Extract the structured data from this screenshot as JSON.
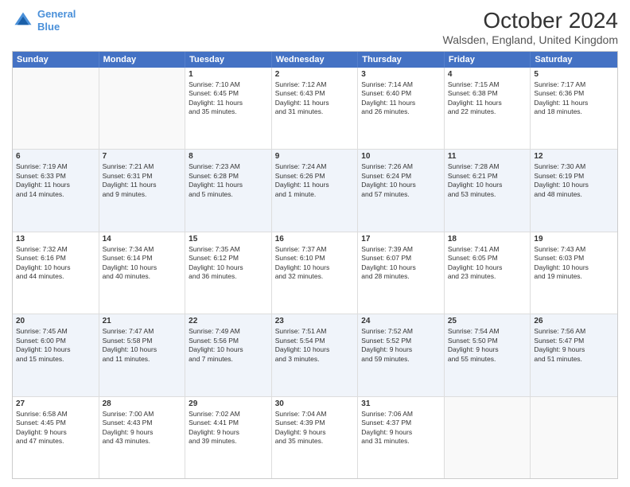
{
  "header": {
    "logo_line1": "General",
    "logo_line2": "Blue",
    "title": "October 2024",
    "subtitle": "Walsden, England, United Kingdom"
  },
  "days": [
    "Sunday",
    "Monday",
    "Tuesday",
    "Wednesday",
    "Thursday",
    "Friday",
    "Saturday"
  ],
  "rows": [
    [
      {
        "day": "",
        "info": [],
        "empty": true
      },
      {
        "day": "",
        "info": [],
        "empty": true
      },
      {
        "day": "1",
        "info": [
          "Sunrise: 7:10 AM",
          "Sunset: 6:45 PM",
          "Daylight: 11 hours",
          "and 35 minutes."
        ],
        "empty": false
      },
      {
        "day": "2",
        "info": [
          "Sunrise: 7:12 AM",
          "Sunset: 6:43 PM",
          "Daylight: 11 hours",
          "and 31 minutes."
        ],
        "empty": false
      },
      {
        "day": "3",
        "info": [
          "Sunrise: 7:14 AM",
          "Sunset: 6:40 PM",
          "Daylight: 11 hours",
          "and 26 minutes."
        ],
        "empty": false
      },
      {
        "day": "4",
        "info": [
          "Sunrise: 7:15 AM",
          "Sunset: 6:38 PM",
          "Daylight: 11 hours",
          "and 22 minutes."
        ],
        "empty": false
      },
      {
        "day": "5",
        "info": [
          "Sunrise: 7:17 AM",
          "Sunset: 6:36 PM",
          "Daylight: 11 hours",
          "and 18 minutes."
        ],
        "empty": false
      }
    ],
    [
      {
        "day": "6",
        "info": [
          "Sunrise: 7:19 AM",
          "Sunset: 6:33 PM",
          "Daylight: 11 hours",
          "and 14 minutes."
        ],
        "empty": false
      },
      {
        "day": "7",
        "info": [
          "Sunrise: 7:21 AM",
          "Sunset: 6:31 PM",
          "Daylight: 11 hours",
          "and 9 minutes."
        ],
        "empty": false
      },
      {
        "day": "8",
        "info": [
          "Sunrise: 7:23 AM",
          "Sunset: 6:28 PM",
          "Daylight: 11 hours",
          "and 5 minutes."
        ],
        "empty": false
      },
      {
        "day": "9",
        "info": [
          "Sunrise: 7:24 AM",
          "Sunset: 6:26 PM",
          "Daylight: 11 hours",
          "and 1 minute."
        ],
        "empty": false
      },
      {
        "day": "10",
        "info": [
          "Sunrise: 7:26 AM",
          "Sunset: 6:24 PM",
          "Daylight: 10 hours",
          "and 57 minutes."
        ],
        "empty": false
      },
      {
        "day": "11",
        "info": [
          "Sunrise: 7:28 AM",
          "Sunset: 6:21 PM",
          "Daylight: 10 hours",
          "and 53 minutes."
        ],
        "empty": false
      },
      {
        "day": "12",
        "info": [
          "Sunrise: 7:30 AM",
          "Sunset: 6:19 PM",
          "Daylight: 10 hours",
          "and 48 minutes."
        ],
        "empty": false
      }
    ],
    [
      {
        "day": "13",
        "info": [
          "Sunrise: 7:32 AM",
          "Sunset: 6:16 PM",
          "Daylight: 10 hours",
          "and 44 minutes."
        ],
        "empty": false
      },
      {
        "day": "14",
        "info": [
          "Sunrise: 7:34 AM",
          "Sunset: 6:14 PM",
          "Daylight: 10 hours",
          "and 40 minutes."
        ],
        "empty": false
      },
      {
        "day": "15",
        "info": [
          "Sunrise: 7:35 AM",
          "Sunset: 6:12 PM",
          "Daylight: 10 hours",
          "and 36 minutes."
        ],
        "empty": false
      },
      {
        "day": "16",
        "info": [
          "Sunrise: 7:37 AM",
          "Sunset: 6:10 PM",
          "Daylight: 10 hours",
          "and 32 minutes."
        ],
        "empty": false
      },
      {
        "day": "17",
        "info": [
          "Sunrise: 7:39 AM",
          "Sunset: 6:07 PM",
          "Daylight: 10 hours",
          "and 28 minutes."
        ],
        "empty": false
      },
      {
        "day": "18",
        "info": [
          "Sunrise: 7:41 AM",
          "Sunset: 6:05 PM",
          "Daylight: 10 hours",
          "and 23 minutes."
        ],
        "empty": false
      },
      {
        "day": "19",
        "info": [
          "Sunrise: 7:43 AM",
          "Sunset: 6:03 PM",
          "Daylight: 10 hours",
          "and 19 minutes."
        ],
        "empty": false
      }
    ],
    [
      {
        "day": "20",
        "info": [
          "Sunrise: 7:45 AM",
          "Sunset: 6:00 PM",
          "Daylight: 10 hours",
          "and 15 minutes."
        ],
        "empty": false
      },
      {
        "day": "21",
        "info": [
          "Sunrise: 7:47 AM",
          "Sunset: 5:58 PM",
          "Daylight: 10 hours",
          "and 11 minutes."
        ],
        "empty": false
      },
      {
        "day": "22",
        "info": [
          "Sunrise: 7:49 AM",
          "Sunset: 5:56 PM",
          "Daylight: 10 hours",
          "and 7 minutes."
        ],
        "empty": false
      },
      {
        "day": "23",
        "info": [
          "Sunrise: 7:51 AM",
          "Sunset: 5:54 PM",
          "Daylight: 10 hours",
          "and 3 minutes."
        ],
        "empty": false
      },
      {
        "day": "24",
        "info": [
          "Sunrise: 7:52 AM",
          "Sunset: 5:52 PM",
          "Daylight: 9 hours",
          "and 59 minutes."
        ],
        "empty": false
      },
      {
        "day": "25",
        "info": [
          "Sunrise: 7:54 AM",
          "Sunset: 5:50 PM",
          "Daylight: 9 hours",
          "and 55 minutes."
        ],
        "empty": false
      },
      {
        "day": "26",
        "info": [
          "Sunrise: 7:56 AM",
          "Sunset: 5:47 PM",
          "Daylight: 9 hours",
          "and 51 minutes."
        ],
        "empty": false
      }
    ],
    [
      {
        "day": "27",
        "info": [
          "Sunrise: 6:58 AM",
          "Sunset: 4:45 PM",
          "Daylight: 9 hours",
          "and 47 minutes."
        ],
        "empty": false
      },
      {
        "day": "28",
        "info": [
          "Sunrise: 7:00 AM",
          "Sunset: 4:43 PM",
          "Daylight: 9 hours",
          "and 43 minutes."
        ],
        "empty": false
      },
      {
        "day": "29",
        "info": [
          "Sunrise: 7:02 AM",
          "Sunset: 4:41 PM",
          "Daylight: 9 hours",
          "and 39 minutes."
        ],
        "empty": false
      },
      {
        "day": "30",
        "info": [
          "Sunrise: 7:04 AM",
          "Sunset: 4:39 PM",
          "Daylight: 9 hours",
          "and 35 minutes."
        ],
        "empty": false
      },
      {
        "day": "31",
        "info": [
          "Sunrise: 7:06 AM",
          "Sunset: 4:37 PM",
          "Daylight: 9 hours",
          "and 31 minutes."
        ],
        "empty": false
      },
      {
        "day": "",
        "info": [],
        "empty": true
      },
      {
        "day": "",
        "info": [],
        "empty": true
      }
    ]
  ]
}
